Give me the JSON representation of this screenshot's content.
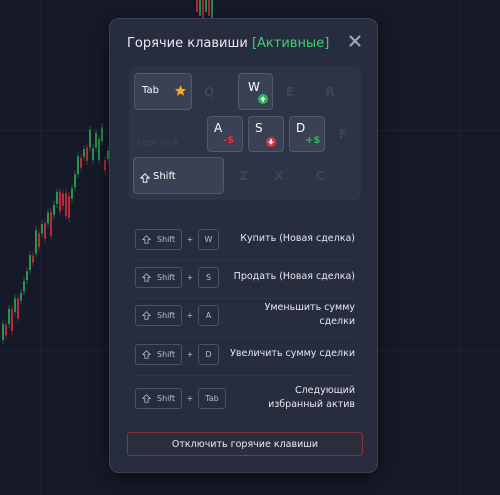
{
  "modal": {
    "title": "Горячие клавиши",
    "status": "[Активные]",
    "accent_color": "#3bd16f"
  },
  "keyboard": {
    "keys": {
      "tab": "Tab",
      "q": "Q",
      "w": "W",
      "e": "E",
      "r": "R",
      "caps": "caps lock",
      "a": "A",
      "s": "S",
      "d": "D",
      "f": "F",
      "shift": "Shift",
      "z": "Z",
      "x": "X",
      "c": "C"
    },
    "badges": {
      "a": "-$",
      "d": "+$"
    }
  },
  "shortcuts": [
    {
      "mod": "Shift",
      "plus": "+",
      "key": "W",
      "label": "Купить (Новая сделка)"
    },
    {
      "mod": "Shift",
      "plus": "+",
      "key": "S",
      "label": "Продать (Новая сделка)"
    },
    {
      "mod": "Shift",
      "plus": "+",
      "key": "A",
      "label": "Уменьшить сумму сделки"
    },
    {
      "mod": "Shift",
      "plus": "+",
      "key": "D",
      "label": "Увеличить сумму сделки"
    },
    {
      "mod": "Shift",
      "plus": "+",
      "key": "Tab",
      "label": "Следующий избранный актив"
    }
  ],
  "footer": {
    "disable_label": "Отключить горячие клавиши"
  },
  "colors": {
    "up": "#2fb35a",
    "down": "#e0323f",
    "star": "#f5a623"
  }
}
